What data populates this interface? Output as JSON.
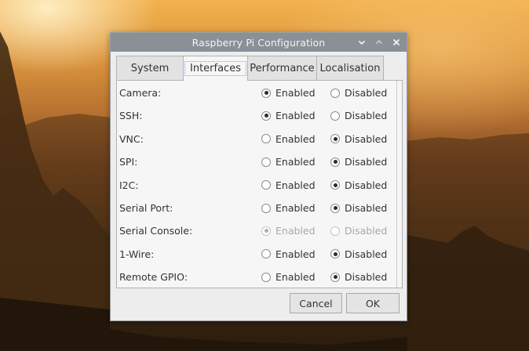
{
  "window": {
    "title": "Raspberry Pi Configuration"
  },
  "tabs": [
    {
      "label": "System",
      "active": false
    },
    {
      "label": "Interfaces",
      "active": true
    },
    {
      "label": "Performance",
      "active": false
    },
    {
      "label": "Localisation",
      "active": false
    }
  ],
  "options": {
    "enabled_label": "Enabled",
    "disabled_label": "Disabled"
  },
  "interfaces": [
    {
      "label": "Camera:",
      "selected": "enabled",
      "sensitive": true
    },
    {
      "label": "SSH:",
      "selected": "enabled",
      "sensitive": true
    },
    {
      "label": "VNC:",
      "selected": "disabled",
      "sensitive": true
    },
    {
      "label": "SPI:",
      "selected": "disabled",
      "sensitive": true
    },
    {
      "label": "I2C:",
      "selected": "disabled",
      "sensitive": true
    },
    {
      "label": "Serial Port:",
      "selected": "disabled",
      "sensitive": true
    },
    {
      "label": "Serial Console:",
      "selected": "enabled",
      "sensitive": false
    },
    {
      "label": "1-Wire:",
      "selected": "disabled",
      "sensitive": true
    },
    {
      "label": "Remote GPIO:",
      "selected": "disabled",
      "sensitive": true
    }
  ],
  "buttons": {
    "cancel": "Cancel",
    "ok": "OK"
  },
  "icons": {
    "minimize": "chevron-down-icon",
    "maximize": "chevron-up-icon",
    "close": "close-icon"
  },
  "colors": {
    "titlebar": "#8a9096",
    "window_bg": "#ededed",
    "panel_bg": "#f6f6f6"
  }
}
